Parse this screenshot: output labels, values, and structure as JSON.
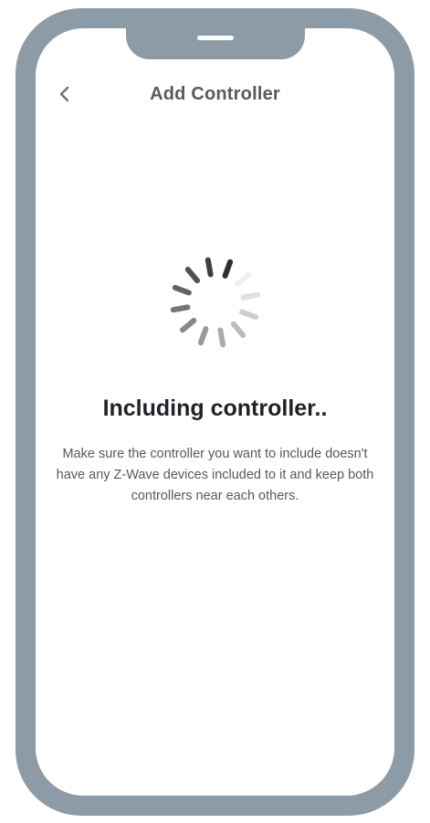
{
  "header": {
    "title": "Add Controller",
    "back_icon": "chevron-left-icon"
  },
  "status": {
    "title": "Including controller..",
    "description": "Make sure the controller you want to include doesn't have any Z-Wave devices included to it and keep both controllers near each others."
  },
  "spinner": {
    "icon": "loading-spinner-icon",
    "color": "#2b2f33"
  },
  "colors": {
    "frame": "#8d9ba6",
    "screen_background": "#ffffff"
  }
}
